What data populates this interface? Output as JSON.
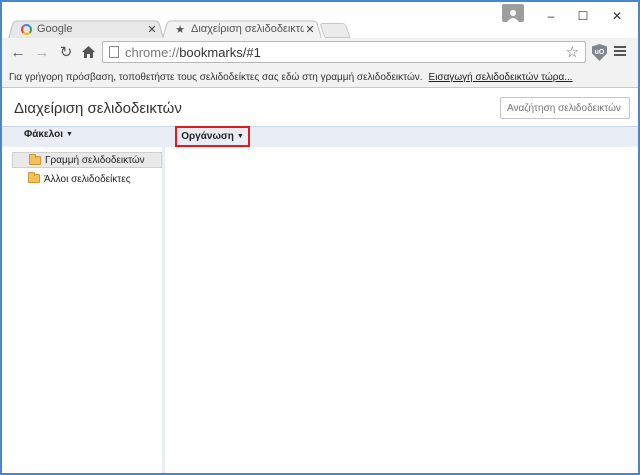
{
  "tabs": [
    {
      "label": "Google",
      "icon": "google-g-icon"
    },
    {
      "label": "Διαχείριση σελιδοδεικτών",
      "icon": "star-icon"
    }
  ],
  "window_controls": {
    "minimize": "–",
    "maximize": "☐",
    "close": "✕"
  },
  "address_bar": {
    "scheme": "chrome://",
    "path": "bookmarks/#1"
  },
  "bookmarks_bar": {
    "message": "Για γρήγορη πρόσβαση, τοποθετήστε τους σελιδοδείκτες σας εδώ στη γραμμή σελιδοδεικτών.",
    "import_link": "Εισαγωγή σελιδοδεικτών τώρα..."
  },
  "page": {
    "title": "Διαχείριση σελιδοδεικτών",
    "search_placeholder": "Αναζήτηση σελιδοδεικτών"
  },
  "toolbar": {
    "folders_label": "Φάκελοι",
    "organize_label": "Οργάνωση"
  },
  "folders": [
    {
      "label": "Γραμμή σελιδοδεικτών",
      "selected": true
    },
    {
      "label": "Άλλοι σελιδοδείκτες",
      "selected": false
    }
  ],
  "colors": {
    "window_border": "#4a86c8",
    "highlight_box": "#e01b1b",
    "header_strip": "#e8edf6"
  }
}
